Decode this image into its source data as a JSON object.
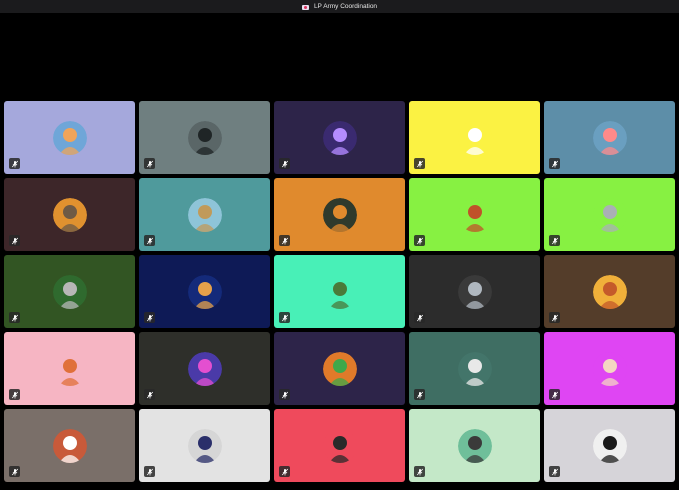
{
  "window": {
    "title": "LP Army Coordination",
    "title_icon": "app-logo-icon"
  },
  "participants": [
    {
      "tile_color": "#a5a8dc",
      "avatar_color": "#6fa6d8",
      "accent": "#f0a45a",
      "muted": true,
      "mute_icon": "mic-off-icon"
    },
    {
      "tile_color": "#6f7f80",
      "avatar_color": "#5a6667",
      "accent": "#1f2526",
      "muted": true,
      "mute_icon": "mic-off-icon"
    },
    {
      "tile_color": "#2d2449",
      "avatar_color": "#3a2a70",
      "accent": "#b48cff",
      "muted": true,
      "mute_icon": "mic-off-icon"
    },
    {
      "tile_color": "#fbf243",
      "avatar_color": "#fbf243",
      "accent": "#ffffff",
      "muted": true,
      "mute_icon": "mic-off-icon"
    },
    {
      "tile_color": "#5d8ea8",
      "avatar_color": "#6a9fc0",
      "accent": "#ff8a8a",
      "muted": true,
      "mute_icon": "mic-off-icon"
    },
    {
      "tile_color": "#3d2629",
      "avatar_color": "#e0912f",
      "accent": "#6e5a45",
      "muted": true,
      "mute_icon": "mic-off-icon"
    },
    {
      "tile_color": "#4f9a9c",
      "avatar_color": "#8ec4d8",
      "accent": "#c09a5a",
      "muted": true,
      "mute_icon": "mic-off-icon"
    },
    {
      "tile_color": "#e08a2d",
      "avatar_color": "#2f3a2c",
      "accent": "#e08a2d",
      "muted": true,
      "mute_icon": "mic-off-icon"
    },
    {
      "tile_color": "#87f142",
      "avatar_color": "#87f142",
      "accent": "#c0522a",
      "muted": true,
      "mute_icon": "mic-off-icon"
    },
    {
      "tile_color": "#87f142",
      "avatar_color": "#87f142",
      "accent": "#aab0b5",
      "muted": true,
      "mute_icon": "mic-off-icon"
    },
    {
      "tile_color": "#325523",
      "avatar_color": "#2f6a2e",
      "accent": "#b7b7b7",
      "muted": true,
      "mute_icon": "mic-off-icon"
    },
    {
      "tile_color": "#0e1a56",
      "avatar_color": "#142a7a",
      "accent": "#e6a14a",
      "muted": true,
      "mute_icon": "mic-off-icon"
    },
    {
      "tile_color": "#48f0b7",
      "avatar_color": "#48f0b7",
      "accent": "#4a7a3a",
      "muted": true,
      "mute_icon": "mic-off-icon"
    },
    {
      "tile_color": "#2c2c2c",
      "avatar_color": "#3a3a3a",
      "accent": "#b0b8c0",
      "muted": true,
      "mute_icon": "mic-off-icon"
    },
    {
      "tile_color": "#543d2a",
      "avatar_color": "#f0b03a",
      "accent": "#c45a2a",
      "muted": true,
      "mute_icon": "mic-off-icon"
    },
    {
      "tile_color": "#f6b5c3",
      "avatar_color": "#f6b5c3",
      "accent": "#e0703a",
      "muted": true,
      "mute_icon": "mic-off-icon"
    },
    {
      "tile_color": "#2e2f2a",
      "avatar_color": "#4a3aa8",
      "accent": "#e44fd0",
      "muted": true,
      "mute_icon": "mic-off-icon"
    },
    {
      "tile_color": "#2d2449",
      "avatar_color": "#e07a2a",
      "accent": "#3fa84a",
      "muted": true,
      "mute_icon": "mic-off-icon"
    },
    {
      "tile_color": "#3f6e63",
      "avatar_color": "#43756a",
      "accent": "#e8e8e8",
      "muted": true,
      "mute_icon": "mic-off-icon"
    },
    {
      "tile_color": "#df45f3",
      "avatar_color": "#df45f3",
      "accent": "#f4d6c2",
      "muted": true,
      "mute_icon": "mic-off-icon"
    },
    {
      "tile_color": "#7a6f69",
      "avatar_color": "#c85a3a",
      "accent": "#ffffff",
      "muted": true,
      "mute_icon": "mic-off-icon"
    },
    {
      "tile_color": "#e3e3e3",
      "avatar_color": "#d6d6d6",
      "accent": "#2a2f6a",
      "muted": true,
      "mute_icon": "mic-off-icon"
    },
    {
      "tile_color": "#ef4a5c",
      "avatar_color": "#ef4a5c",
      "accent": "#2a2a2a",
      "muted": true,
      "mute_icon": "mic-off-icon"
    },
    {
      "tile_color": "#c4e8c8",
      "avatar_color": "#6fbf9a",
      "accent": "#3a3a3a",
      "muted": true,
      "mute_icon": "mic-off-icon"
    },
    {
      "tile_color": "#d6d4d9",
      "avatar_color": "#f0f0f0",
      "accent": "#1a1a1a",
      "muted": true,
      "mute_icon": "mic-off-icon"
    }
  ]
}
